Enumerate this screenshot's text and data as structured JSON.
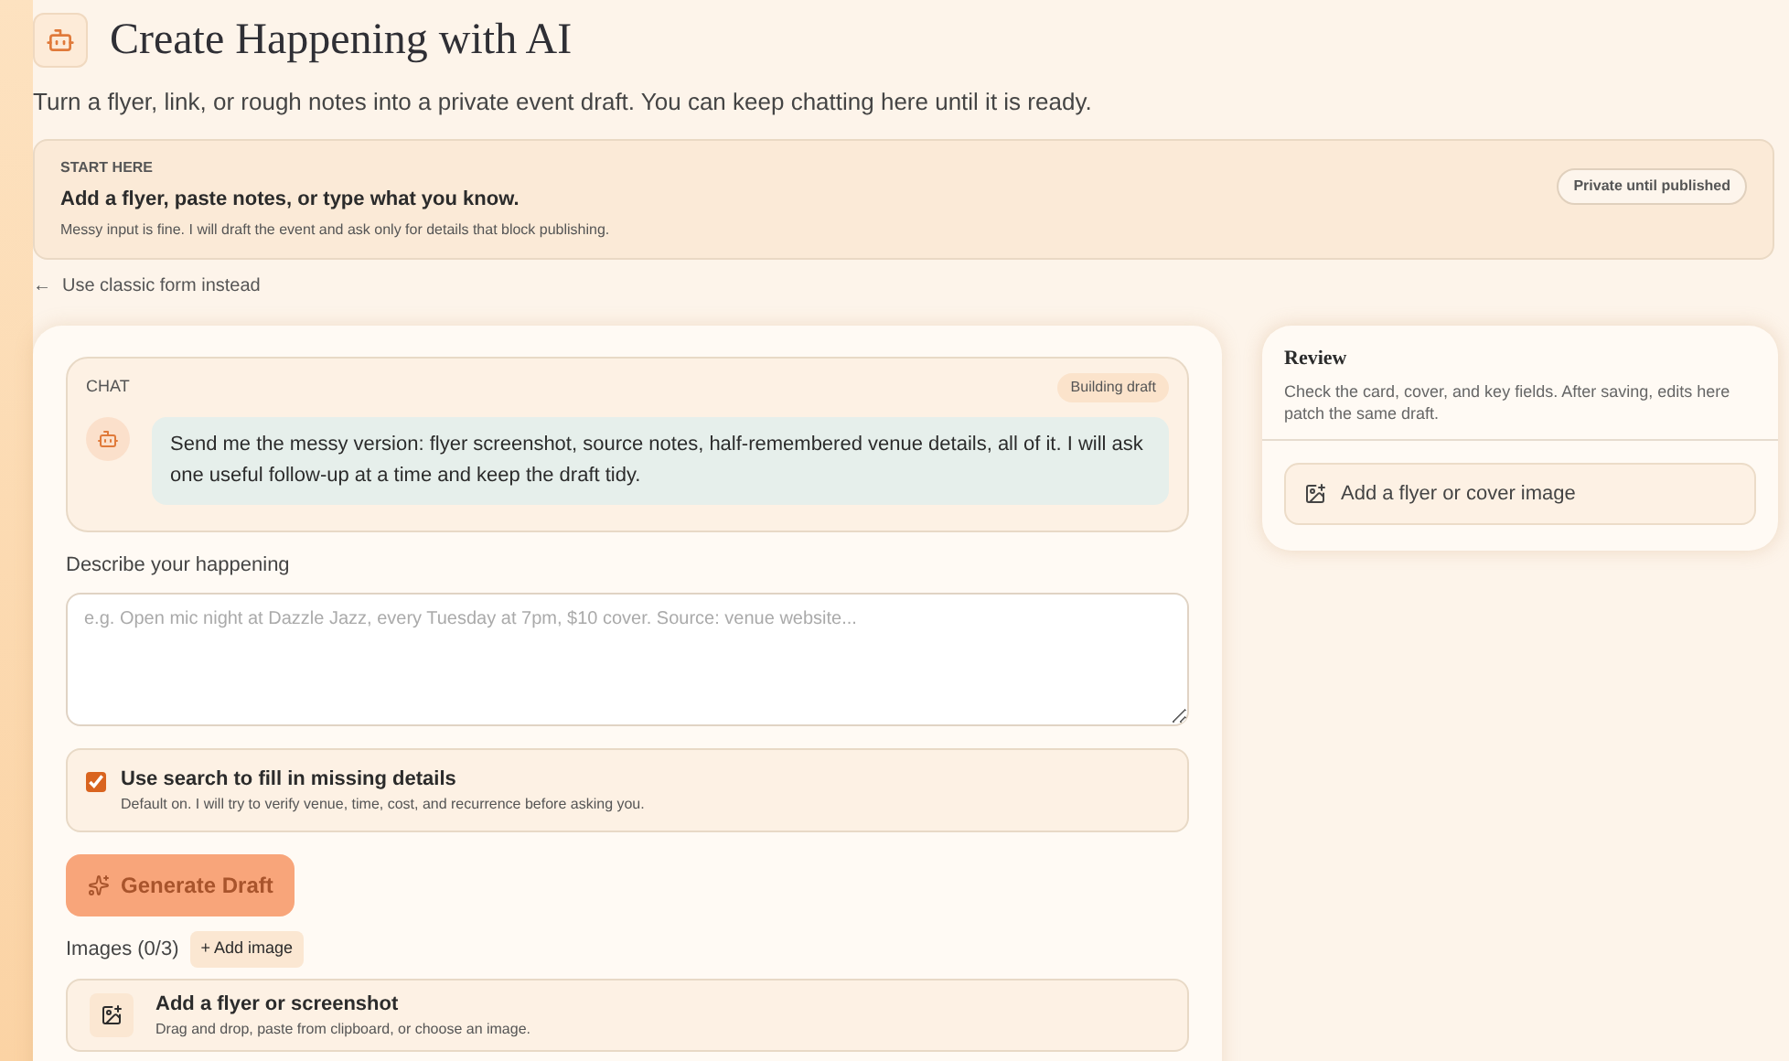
{
  "header": {
    "title": "Create Happening with AI",
    "subtitle": "Turn a flyer, link, or rough notes into a private event draft. You can keep chatting here until it is ready."
  },
  "start_card": {
    "eyebrow": "START HERE",
    "heading": "Add a flyer, paste notes, or type what you know.",
    "body": "Messy input is fine. I will draft the event and ask only for details that block publishing.",
    "badge": "Private until published"
  },
  "back_link": {
    "arrow": "←",
    "label": "Use classic form instead"
  },
  "chat": {
    "label": "CHAT",
    "status": "Building draft",
    "messages": [
      {
        "text": "Send me the messy version: flyer screenshot, source notes, half-remembered venue details, all of it. I will ask one useful follow-up at a time and keep the draft tidy."
      }
    ]
  },
  "describe": {
    "label": "Describe your happening",
    "placeholder": "e.g. Open mic night at Dazzle Jazz, every Tuesday at 7pm, $10 cover. Source: venue website..."
  },
  "search_option": {
    "label": "Use search to fill in missing details",
    "hint": "Default on. I will try to verify venue, time, cost, and recurrence before asking you.",
    "checked": true
  },
  "generate_button": {
    "label": "Generate Draft",
    "disabled": true
  },
  "images": {
    "label": "Images (0/3)",
    "add": "+ Add image",
    "drop_title": "Add a flyer or screenshot",
    "drop_hint": "Drag and drop, paste from clipboard, or choose an image."
  },
  "review": {
    "title": "Review",
    "body": "Check the card, cover, and key fields. After saving, edits here patch the same draft.",
    "add_cover": "Add a flyer or cover image"
  }
}
